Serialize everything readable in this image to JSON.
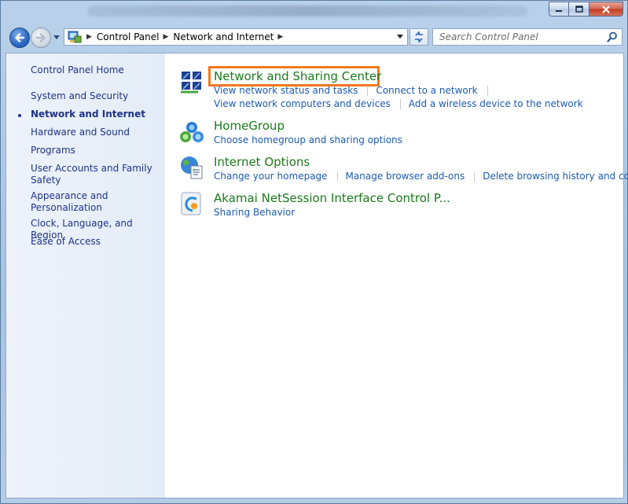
{
  "window": {
    "controls": [
      "minimize-icon",
      "maximize-icon",
      "close-icon"
    ]
  },
  "address": {
    "crumbs": [
      "Control Panel",
      "Network and Internet"
    ]
  },
  "search": {
    "placeholder": "Search Control Panel"
  },
  "sidebar": {
    "items": [
      {
        "label": "Control Panel Home"
      },
      {
        "label": "System and Security"
      },
      {
        "label": "Network and Internet",
        "current": true
      },
      {
        "label": "Hardware and Sound"
      },
      {
        "label": "Programs"
      },
      {
        "label": "User Accounts and Family Safety"
      },
      {
        "label": "Appearance and Personalization"
      },
      {
        "label": "Clock, Language, and Region"
      },
      {
        "label": "Ease of Access"
      }
    ]
  },
  "categories": [
    {
      "title": "Network and Sharing Center",
      "icon": "network-sharing-icon",
      "links_row1": [
        "View network status and tasks",
        "Connect to a network"
      ],
      "links_row2": [
        "View network computers and devices",
        "Add a wireless device to the network"
      ]
    },
    {
      "title": "HomeGroup",
      "icon": "homegroup-icon",
      "links_row1": [
        "Choose homegroup and sharing options"
      ]
    },
    {
      "title": "Internet Options",
      "icon": "internet-options-icon",
      "links_row1": [
        "Change your homepage",
        "Manage browser add-ons",
        "Delete browsing history and cookies"
      ]
    },
    {
      "title": "Akamai NetSession Interface Control P...",
      "icon": "akamai-icon",
      "links_row1": [
        "Sharing Behavior"
      ]
    }
  ],
  "colors": {
    "highlight": "#f07a1e",
    "title_green": "#1a7a1a",
    "link_blue": "#1c5bb0"
  }
}
